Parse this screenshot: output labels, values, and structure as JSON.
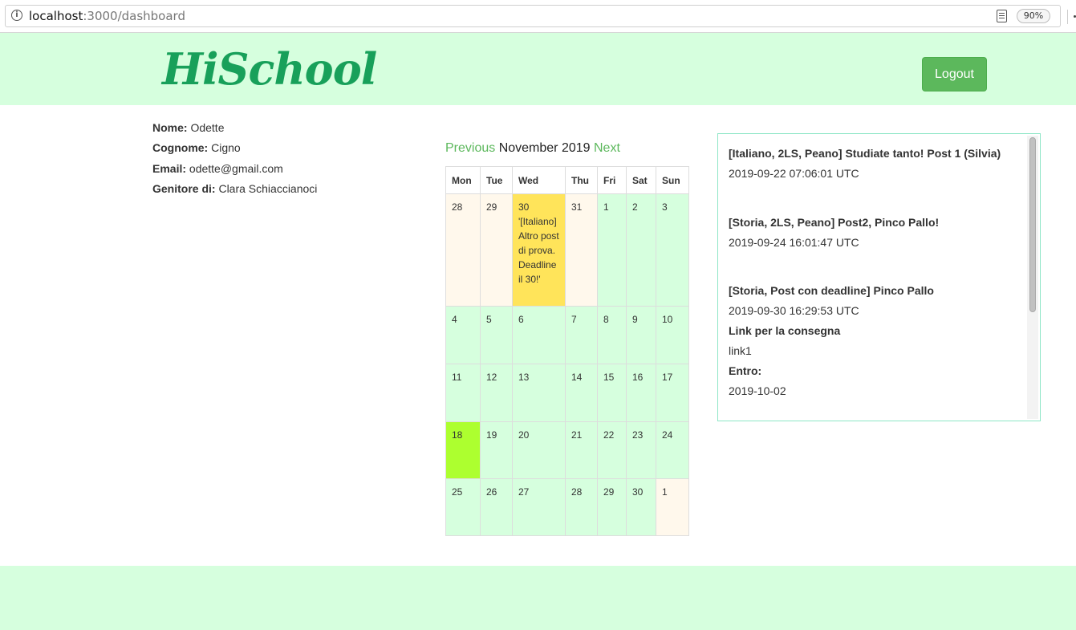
{
  "browser": {
    "url_host": "localhost",
    "url_rest": ":3000/dashboard",
    "zoom": "90%"
  },
  "header": {
    "logo": "HiSchool",
    "logout_label": "Logout",
    "bg_color": "#d6ffde",
    "logout_color": "#5cb85c"
  },
  "profile": {
    "nome_label": "Nome:",
    "nome": "Odette",
    "cognome_label": "Cognome:",
    "cognome": "Cigno",
    "email_label": "Email:",
    "email": "odette@gmail.com",
    "genitore_label": "Genitore di:",
    "genitore": "Clara Schiaccianoci"
  },
  "calendar": {
    "prev_label": "Previous",
    "month_label": "November 2019",
    "next_label": "Next",
    "weekdays": [
      "Mon",
      "Tue",
      "Wed",
      "Thu",
      "Fri",
      "Sat",
      "Sun"
    ],
    "weeks": [
      [
        {
          "day": "28",
          "type": "other"
        },
        {
          "day": "29",
          "type": "other"
        },
        {
          "day": "30",
          "type": "event",
          "event": "'[Italiano] Altro post di prova. Deadline il 30!'"
        },
        {
          "day": "31",
          "type": "other"
        },
        {
          "day": "1",
          "type": "current"
        },
        {
          "day": "2",
          "type": "current"
        },
        {
          "day": "3",
          "type": "current"
        }
      ],
      [
        {
          "day": "4",
          "type": "current"
        },
        {
          "day": "5",
          "type": "current"
        },
        {
          "day": "6",
          "type": "current"
        },
        {
          "day": "7",
          "type": "current"
        },
        {
          "day": "8",
          "type": "current"
        },
        {
          "day": "9",
          "type": "current"
        },
        {
          "day": "10",
          "type": "current"
        }
      ],
      [
        {
          "day": "11",
          "type": "current"
        },
        {
          "day": "12",
          "type": "current"
        },
        {
          "day": "13",
          "type": "current"
        },
        {
          "day": "14",
          "type": "current"
        },
        {
          "day": "15",
          "type": "current"
        },
        {
          "day": "16",
          "type": "current"
        },
        {
          "day": "17",
          "type": "current"
        }
      ],
      [
        {
          "day": "18",
          "type": "today"
        },
        {
          "day": "19",
          "type": "current"
        },
        {
          "day": "20",
          "type": "current"
        },
        {
          "day": "21",
          "type": "current"
        },
        {
          "day": "22",
          "type": "current"
        },
        {
          "day": "23",
          "type": "current"
        },
        {
          "day": "24",
          "type": "current"
        }
      ],
      [
        {
          "day": "25",
          "type": "current"
        },
        {
          "day": "26",
          "type": "current"
        },
        {
          "day": "27",
          "type": "current"
        },
        {
          "day": "28",
          "type": "current"
        },
        {
          "day": "29",
          "type": "current"
        },
        {
          "day": "30",
          "type": "current"
        },
        {
          "day": "1",
          "type": "other"
        }
      ]
    ]
  },
  "posts": [
    {
      "title": "[Italiano, 2LS, Peano] Studiate tanto! Post 1 (Silvia)",
      "date": "2019-09-22 07:06:01 UTC"
    },
    {
      "title": "[Storia, 2LS, Peano] Post2, Pinco Pallo!",
      "date": "2019-09-24 16:01:47 UTC"
    },
    {
      "title": "[Storia, Post con deadline] Pinco Pallo",
      "date": "2019-09-30 16:29:53 UTC",
      "link_label": "Link per la consegna",
      "link": "link1",
      "entro_label": "Entro:",
      "entro": "2019-10-02"
    }
  ]
}
